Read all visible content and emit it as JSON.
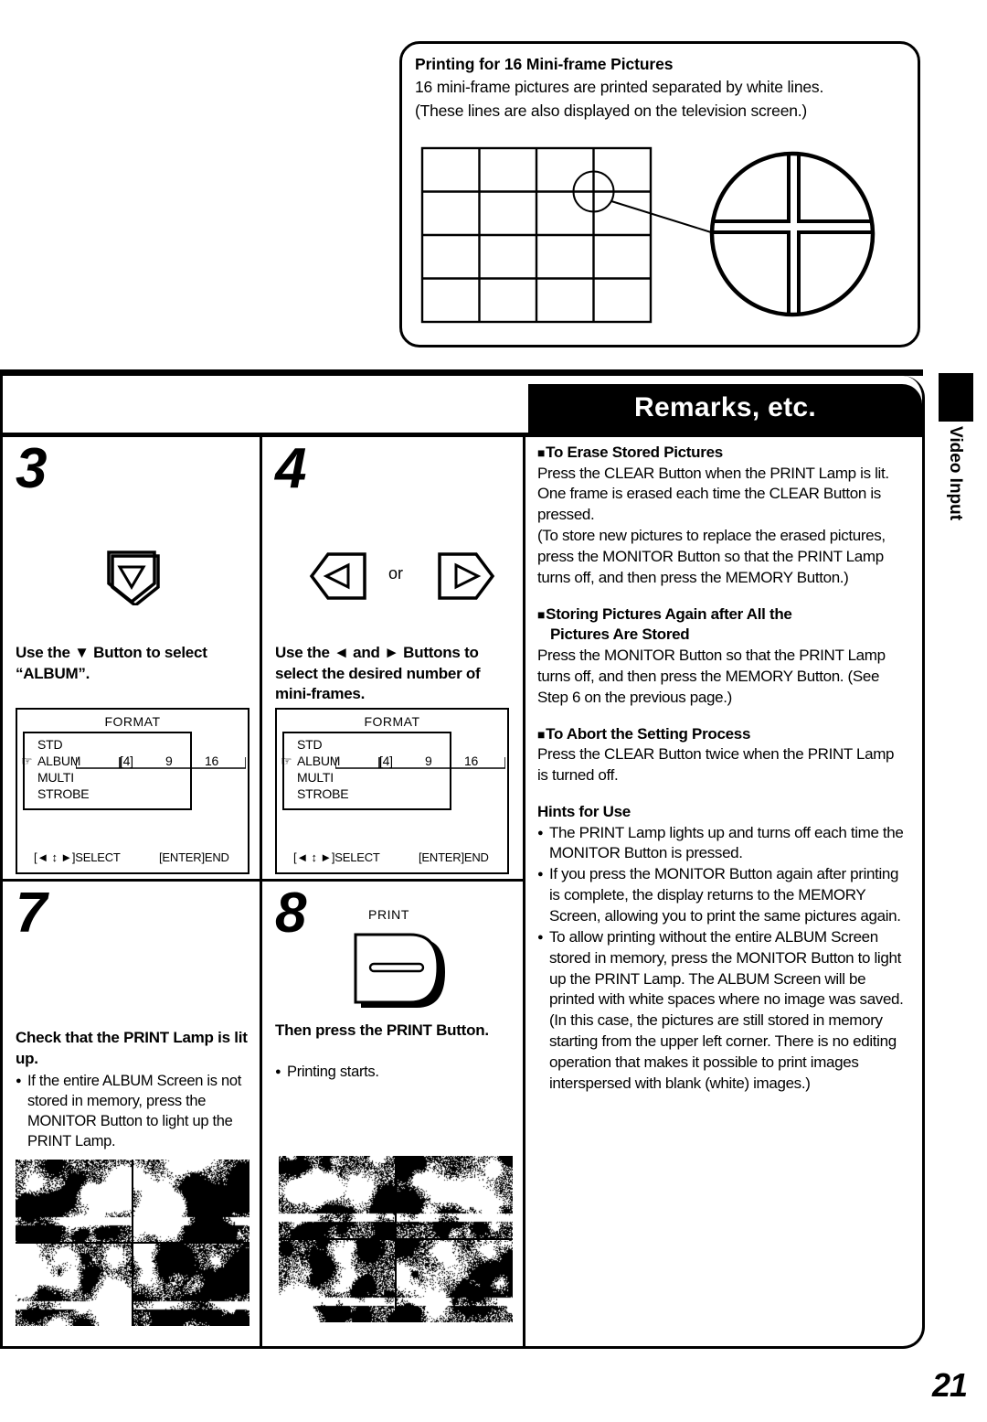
{
  "top_box": {
    "title": "Printing for 16 Mini-frame Pictures",
    "line1": "16 mini-frame pictures are printed separated by white lines.",
    "line2": "(These lines are also displayed on the television screen.)",
    "figure": {
      "type": "grid-with-magnifier",
      "rows": 4,
      "columns": 4,
      "magnified_detail": "cross-intersection-of-white-lines"
    }
  },
  "banner": {
    "title": "Remarks, etc."
  },
  "side_tab": {
    "label": "Video Input"
  },
  "page_number": "21",
  "steps": [
    {
      "number": "3",
      "icon": "down-button-icon",
      "caption": "Use the ▼ Button to select “ALBUM”.",
      "osd": {
        "title": "FORMAT",
        "items": [
          "STD",
          "ALBUM",
          "MULTI",
          "STROBE"
        ],
        "pointer_item": "ALBUM",
        "options": [
          "[4]",
          "9",
          "16"
        ],
        "selected_option": "[4]",
        "footer_left": "[◄ ↕ ►]SELECT",
        "footer_right": "[ENTER]END"
      }
    },
    {
      "number": "4",
      "icon_left": "left-button-icon",
      "icon_separator": "or",
      "icon_right": "right-button-icon",
      "caption": "Use the ◄ and ► Buttons to select the desired number of mini-frames.",
      "osd": {
        "title": "FORMAT",
        "items": [
          "STD",
          "ALBUM",
          "MULTI",
          "STROBE"
        ],
        "pointer_item": "ALBUM",
        "options": [
          "[4]",
          "9",
          "16"
        ],
        "selected_option": "[4]",
        "footer_left": "[◄ ↕ ►]SELECT",
        "footer_right": "[ENTER]END"
      }
    },
    {
      "number": "7",
      "caption": "Check that the PRINT Lamp is lit up.",
      "bullets": [
        "If the entire ALBUM Screen is not stored in memory, press the MONITOR Button to light up the PRINT Lamp."
      ],
      "photo": "album-screen-4-pictures"
    },
    {
      "number": "8",
      "icon": "print-button-icon",
      "icon_label": "PRINT",
      "caption": "Then press the PRINT Button.",
      "bullets": [
        "Printing starts."
      ],
      "photo": "album-screen-4-pictures"
    }
  ],
  "remarks": {
    "sections": [
      {
        "heading": "To Erase Stored Pictures",
        "heading_marker": true,
        "paragraphs": [
          "Press the CLEAR Button when the PRINT Lamp is lit. One frame is erased each time the CLEAR Button is pressed.",
          "(To store new pictures to replace the erased pictures, press the MONITOR Button so that the PRINT Lamp turns off, and then press the MEMORY Button.)"
        ]
      },
      {
        "heading": "Storing Pictures Again after All the",
        "heading_line2": "Pictures Are Stored",
        "heading_marker": true,
        "paragraphs": [
          "Press the MONITOR Button so that the PRINT Lamp turns off, and then press the MEMORY Button. (See Step 6 on the previous page.)"
        ]
      },
      {
        "heading": "To Abort the Setting Process",
        "heading_marker": true,
        "paragraphs": [
          "Press the CLEAR Button twice when the PRINT Lamp is turned off."
        ]
      },
      {
        "heading": "Hints for Use",
        "heading_marker": false,
        "bullets": [
          "The PRINT Lamp lights up and turns off each time the MONITOR Button is pressed.",
          "If you press the MONITOR Button again after printing is complete, the display returns to the MEMORY Screen, allowing you to print the same pictures again.",
          "To allow printing without the entire ALBUM Screen stored in memory, press the MONITOR Button to light up the PRINT Lamp. The ALBUM Screen will be printed with white spaces where no image was saved. (In this case, the pictures are still stored in memory starting from the upper left corner. There is no editing operation that makes it possible to print images interspersed with blank (white) images.)"
        ]
      }
    ]
  },
  "colors": {
    "ink": "#000000",
    "paper": "#ffffff"
  }
}
